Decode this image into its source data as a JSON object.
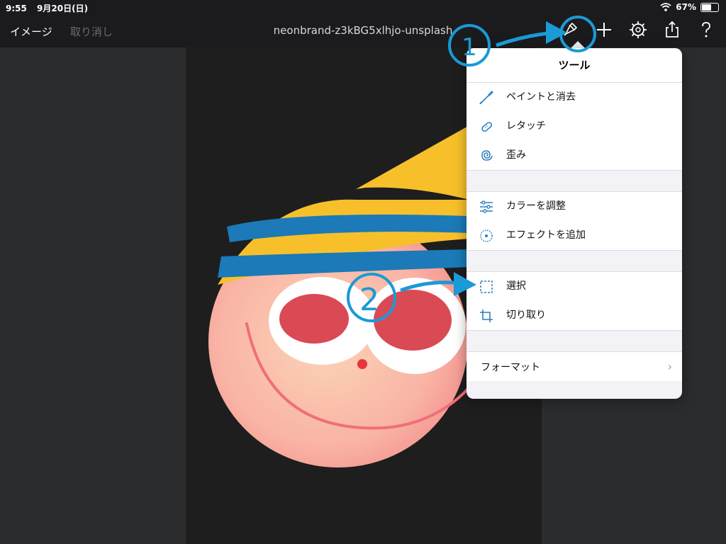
{
  "status_bar": {
    "time": "9:55",
    "date": "9月20日(日)",
    "battery_percent": "67%",
    "battery_level": 0.67
  },
  "nav": {
    "left_button": "イメージ",
    "undo_button": "取り消し",
    "title": "neonbrand-z3kBG5xlhjo-unsplash"
  },
  "nav_icons": [
    "tools-brush-icon",
    "plus-icon",
    "gear-icon",
    "share-icon",
    "help-icon"
  ],
  "popover": {
    "title": "ツール",
    "groups": [
      [
        {
          "label": "ペイントと消去",
          "icon": "brush-icon"
        },
        {
          "label": "レタッチ",
          "icon": "bandage-icon"
        },
        {
          "label": "歪み",
          "icon": "spiral-icon"
        }
      ],
      [
        {
          "label": "カラーを調整",
          "icon": "sliders-icon"
        },
        {
          "label": "エフェクトを追加",
          "icon": "sparkle-icon"
        }
      ],
      [
        {
          "label": "選択",
          "icon": "selection-icon"
        },
        {
          "label": "切り取り",
          "icon": "crop-icon"
        }
      ]
    ],
    "format_label": "フォーマット"
  },
  "annotations": [
    {
      "text": "1"
    },
    {
      "text": "2"
    }
  ],
  "colors": {
    "accent": "#1a9ad6",
    "icon": "#2f7fc0",
    "popover_bg": "#f2f2f7"
  }
}
